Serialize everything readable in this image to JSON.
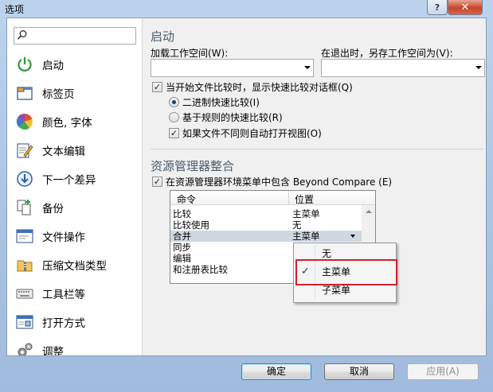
{
  "window": {
    "title": "选项",
    "help_label": "?",
    "close_label": "✕"
  },
  "search": {
    "placeholder": "",
    "value": ""
  },
  "sidebar": {
    "items": [
      {
        "label": "启动",
        "icon": "power-icon"
      },
      {
        "label": "标签页",
        "icon": "tabs-icon"
      },
      {
        "label": "颜色, 字体",
        "icon": "palette-icon"
      },
      {
        "label": "文本编辑",
        "icon": "text-edit-icon"
      },
      {
        "label": "下一个差异",
        "icon": "next-diff-icon"
      },
      {
        "label": "备份",
        "icon": "backup-icon"
      },
      {
        "label": "文件操作",
        "icon": "file-ops-icon"
      },
      {
        "label": "压缩文档类型",
        "icon": "archive-icon"
      },
      {
        "label": "工具栏等",
        "icon": "keyboard-icon"
      },
      {
        "label": "打开方式",
        "icon": "open-with-icon"
      },
      {
        "label": "调整",
        "icon": "gear-icon"
      }
    ]
  },
  "startup": {
    "title": "启动",
    "load_workspace_label": "加载工作空间(W):",
    "load_workspace_value": "",
    "save_workspace_label": "在退出时，另存工作空间为(V):",
    "save_workspace_value": "",
    "show_quick_compare": {
      "label": "当开始文件比较时，显示快速比较对话框(Q)",
      "checked": true
    },
    "binary_quick": {
      "label": "二进制快速比较(I)",
      "selected": true
    },
    "rule_quick": {
      "label": "基于规则的快速比较(R)",
      "selected": false
    },
    "auto_open_view": {
      "label": "如果文件不同则自动打开视图(O)",
      "checked": true
    }
  },
  "explorer": {
    "title": "资源管理器整合",
    "include_in_menu": {
      "label": "在资源管理器环境菜单中包含 Beyond Compare (E)",
      "checked": true
    },
    "table": {
      "headers": [
        "命令",
        "位置"
      ],
      "rows": [
        {
          "command": "比较",
          "position": "主菜单"
        },
        {
          "command": "比较使用",
          "position": "无"
        },
        {
          "command": "合并",
          "position": "主菜单"
        },
        {
          "command": "同步",
          "position": ""
        },
        {
          "command": "编辑",
          "position": ""
        },
        {
          "command": "和注册表比较",
          "position": ""
        }
      ]
    },
    "dropdown_options": [
      {
        "label": "无",
        "checked": false
      },
      {
        "label": "主菜单",
        "checked": true
      },
      {
        "label": "子菜单",
        "checked": false
      }
    ],
    "check_mark": "✓"
  },
  "buttons": {
    "ok": "确定",
    "cancel": "取消",
    "apply": "应用(A)"
  },
  "colors": {
    "highlight_box": "#d0212a",
    "selected_row": "#cfd7e1"
  }
}
